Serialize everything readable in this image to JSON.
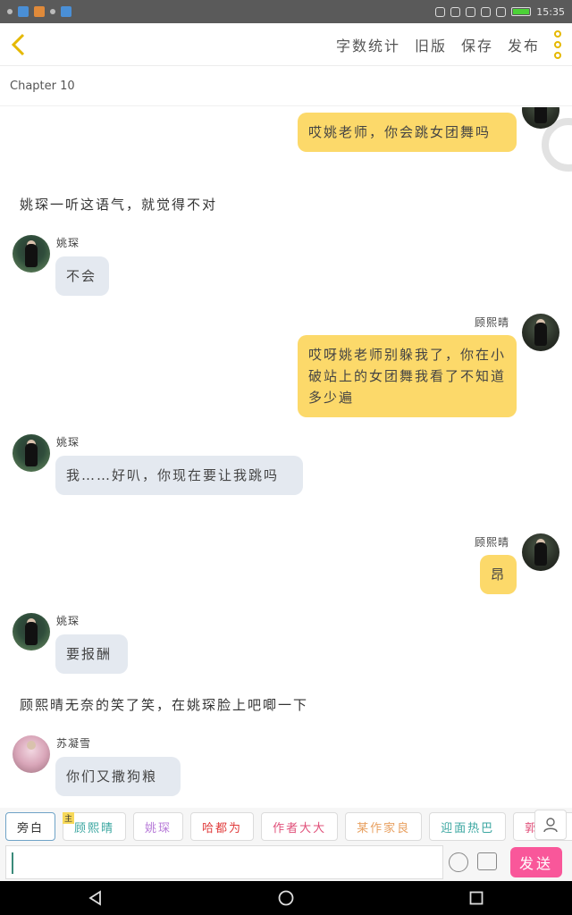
{
  "status_bar": {
    "time": "15:35"
  },
  "top_bar": {
    "actions": [
      "字数统计",
      "旧版",
      "保存",
      "发布"
    ]
  },
  "chapter": {
    "title": "Chapter 10"
  },
  "messages": [
    {
      "type": "me",
      "text": "哎姚老师，你会跳女团舞吗"
    },
    {
      "type": "narration",
      "text": "姚琛一听这语气，就觉得不对"
    },
    {
      "type": "other",
      "name": "姚琛",
      "text": "不会"
    },
    {
      "type": "me",
      "name": "顾熙晴",
      "text": "哎呀姚老师别躲我了，你在小破站上的女团舞我看了不知道多少遍"
    },
    {
      "type": "other",
      "name": "姚琛",
      "text": "我……好叭，你现在要让我跳吗"
    },
    {
      "type": "me",
      "name": "顾熙晴",
      "text": "昂"
    },
    {
      "type": "other",
      "name": "姚琛",
      "text": "要报酬"
    },
    {
      "type": "narration",
      "text": "顾熙晴无奈的笑了笑，在姚琛脸上吧唧一下"
    },
    {
      "type": "other",
      "name": "苏凝雪",
      "text": "你们又撒狗粮"
    }
  ],
  "roles": {
    "narration_label": "旁白",
    "main_tag": "主",
    "items": [
      {
        "label": "顾熙晴",
        "color": "#3aa6a0"
      },
      {
        "label": "姚琛",
        "color": "#b77ad8"
      },
      {
        "label": "哈都为",
        "color": "#e03b3b"
      },
      {
        "label": "作者大大",
        "color": "#e0507a"
      },
      {
        "label": "某作家良",
        "color": "#e8a060"
      },
      {
        "label": "迎面热巴",
        "color": "#3aa6a0"
      },
      {
        "label": "郭富城",
        "color": "#e0507a"
      }
    ]
  },
  "input": {
    "value": "",
    "send_label": "发送"
  },
  "colors": {
    "accent_yellow": "#fcd96a",
    "bubble_other": "#e4e9f0",
    "send": "#f9579a"
  }
}
